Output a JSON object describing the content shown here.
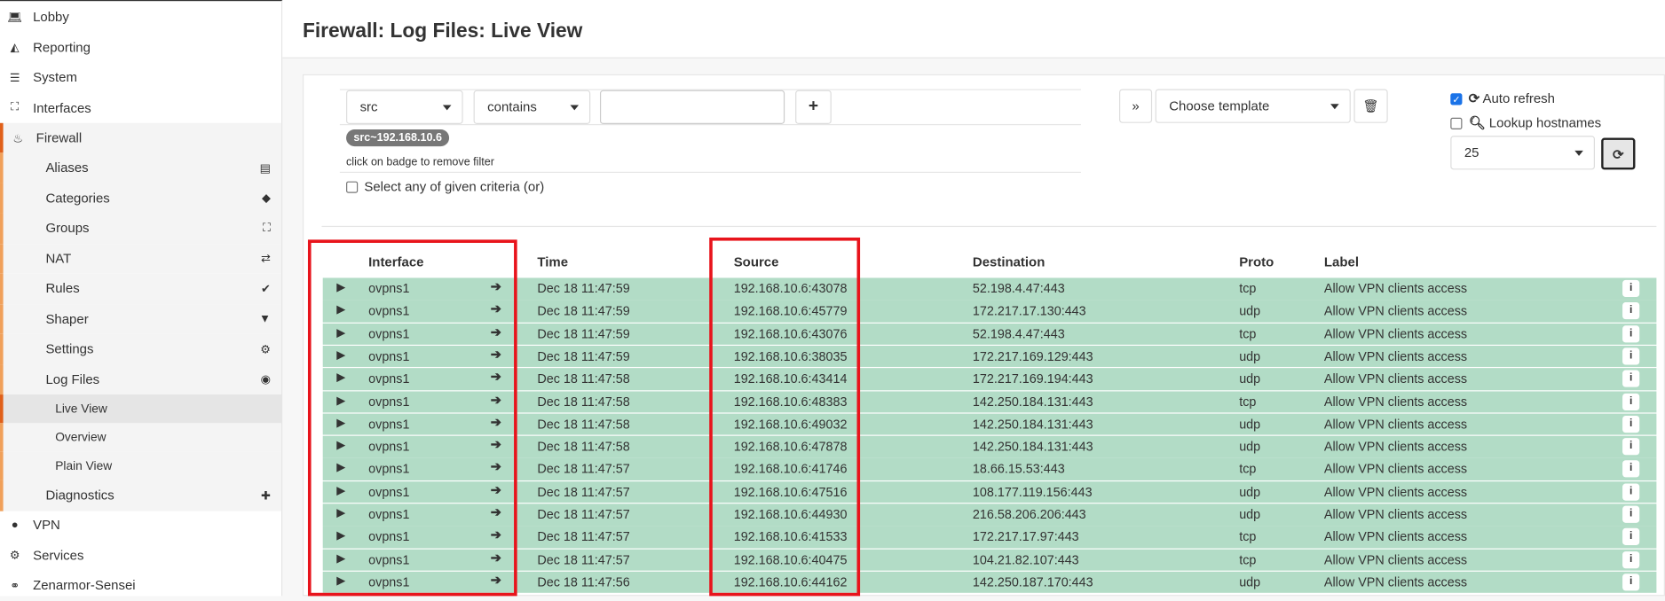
{
  "sidebar": {
    "items": [
      {
        "label": "Lobby",
        "icon": "laptop-icon"
      },
      {
        "label": "Reporting",
        "icon": "area-chart-icon"
      },
      {
        "label": "System",
        "icon": "server-icon"
      },
      {
        "label": "Interfaces",
        "icon": "sitemap-icon"
      },
      {
        "label": "Firewall",
        "icon": "fire-icon"
      }
    ],
    "firewall_items": [
      {
        "label": "Aliases",
        "icon": "list-alt-icon"
      },
      {
        "label": "Categories",
        "icon": "tags-icon"
      },
      {
        "label": "Groups",
        "icon": "sitemap-icon"
      },
      {
        "label": "NAT",
        "icon": "exchange-icon"
      },
      {
        "label": "Rules",
        "icon": "check-icon"
      },
      {
        "label": "Shaper",
        "icon": "filter-icon"
      },
      {
        "label": "Settings",
        "icon": "cogs-icon"
      },
      {
        "label": "Log Files",
        "icon": "eye-icon"
      }
    ],
    "log_items": [
      {
        "label": "Live View"
      },
      {
        "label": "Overview"
      },
      {
        "label": "Plain View"
      }
    ],
    "diagnostics": {
      "label": "Diagnostics",
      "icon": "medkit-icon"
    },
    "bottom_items": [
      {
        "label": "VPN",
        "icon": "globe-icon"
      },
      {
        "label": "Services",
        "icon": "cog-icon"
      },
      {
        "label": "Zenarmor-Sensei",
        "icon": "binoculars-icon"
      }
    ]
  },
  "header": {
    "title": "Firewall: Log Files: Live View"
  },
  "filter": {
    "field": "src",
    "operator": "contains",
    "value": "",
    "add_label": "+",
    "badge": "src~192.168.10.6",
    "hint": "click on badge to remove filter",
    "or_label": "Select any of given criteria (or)",
    "or_checked": false
  },
  "template": {
    "expand_label": "»",
    "placeholder": "Choose template"
  },
  "options": {
    "auto_refresh_label": "Auto refresh",
    "auto_refresh": true,
    "lookup_label": "Lookup hostnames",
    "lookup": false,
    "limit": "25"
  },
  "table": {
    "headers": {
      "interface": "Interface",
      "time": "Time",
      "source": "Source",
      "destination": "Destination",
      "proto": "Proto",
      "label": "Label"
    },
    "rows": [
      {
        "interface": "ovpns1",
        "time": "Dec 18 11:47:59",
        "source": "192.168.10.6:43078",
        "destination": "52.198.4.47:443",
        "proto": "tcp",
        "label": "Allow VPN clients access"
      },
      {
        "interface": "ovpns1",
        "time": "Dec 18 11:47:59",
        "source": "192.168.10.6:45779",
        "destination": "172.217.17.130:443",
        "proto": "udp",
        "label": "Allow VPN clients access"
      },
      {
        "interface": "ovpns1",
        "time": "Dec 18 11:47:59",
        "source": "192.168.10.6:43076",
        "destination": "52.198.4.47:443",
        "proto": "tcp",
        "label": "Allow VPN clients access"
      },
      {
        "interface": "ovpns1",
        "time": "Dec 18 11:47:59",
        "source": "192.168.10.6:38035",
        "destination": "172.217.169.129:443",
        "proto": "udp",
        "label": "Allow VPN clients access"
      },
      {
        "interface": "ovpns1",
        "time": "Dec 18 11:47:58",
        "source": "192.168.10.6:43414",
        "destination": "172.217.169.194:443",
        "proto": "udp",
        "label": "Allow VPN clients access"
      },
      {
        "interface": "ovpns1",
        "time": "Dec 18 11:47:58",
        "source": "192.168.10.6:48383",
        "destination": "142.250.184.131:443",
        "proto": "tcp",
        "label": "Allow VPN clients access"
      },
      {
        "interface": "ovpns1",
        "time": "Dec 18 11:47:58",
        "source": "192.168.10.6:49032",
        "destination": "142.250.184.131:443",
        "proto": "udp",
        "label": "Allow VPN clients access"
      },
      {
        "interface": "ovpns1",
        "time": "Dec 18 11:47:58",
        "source": "192.168.10.6:47878",
        "destination": "142.250.184.131:443",
        "proto": "udp",
        "label": "Allow VPN clients access"
      },
      {
        "interface": "ovpns1",
        "time": "Dec 18 11:47:57",
        "source": "192.168.10.6:41746",
        "destination": "18.66.15.53:443",
        "proto": "tcp",
        "label": "Allow VPN clients access"
      },
      {
        "interface": "ovpns1",
        "time": "Dec 18 11:47:57",
        "source": "192.168.10.6:47516",
        "destination": "108.177.119.156:443",
        "proto": "udp",
        "label": "Allow VPN clients access"
      },
      {
        "interface": "ovpns1",
        "time": "Dec 18 11:47:57",
        "source": "192.168.10.6:44930",
        "destination": "216.58.206.206:443",
        "proto": "udp",
        "label": "Allow VPN clients access"
      },
      {
        "interface": "ovpns1",
        "time": "Dec 18 11:47:57",
        "source": "192.168.10.6:41533",
        "destination": "172.217.17.97:443",
        "proto": "tcp",
        "label": "Allow VPN clients access"
      },
      {
        "interface": "ovpns1",
        "time": "Dec 18 11:47:57",
        "source": "192.168.10.6:40475",
        "destination": "104.21.82.107:443",
        "proto": "tcp",
        "label": "Allow VPN clients access"
      },
      {
        "interface": "ovpns1",
        "time": "Dec 18 11:47:56",
        "source": "192.168.10.6:44162",
        "destination": "142.250.187.170:443",
        "proto": "udp",
        "label": "Allow VPN clients access"
      }
    ]
  },
  "colors": {
    "pass_row": "#b2dcc6",
    "accent": "#f0a05a",
    "highlight": "#e8141c"
  }
}
